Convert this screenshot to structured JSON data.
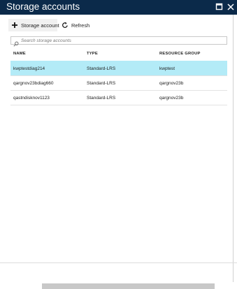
{
  "blade": {
    "title": "Storage accounts"
  },
  "commands": {
    "add_label": "Storage account",
    "refresh_label": "Refresh"
  },
  "search": {
    "placeholder": "Search storage accounts",
    "value": ""
  },
  "table": {
    "columns": [
      "NAME",
      "TYPE",
      "RESOURCE GROUP"
    ],
    "rows": [
      {
        "name": "kwptestdiag214",
        "type": "Standard-LRS",
        "group": "kwptest",
        "selected": true
      },
      {
        "name": "qargnov23bdiag660",
        "type": "Standard-LRS",
        "group": "qargnov23b",
        "selected": false
      },
      {
        "name": "qastndisknov1123",
        "type": "Standard-LRS",
        "group": "qargnov23b",
        "selected": false
      }
    ]
  },
  "colors": {
    "titlebar": "#0b2a4a",
    "selected_row": "#b3ebf7"
  },
  "icons": {
    "add": "plus-icon",
    "refresh": "refresh-icon",
    "search": "search-icon",
    "maximize": "maximize-icon",
    "close": "close-icon"
  }
}
